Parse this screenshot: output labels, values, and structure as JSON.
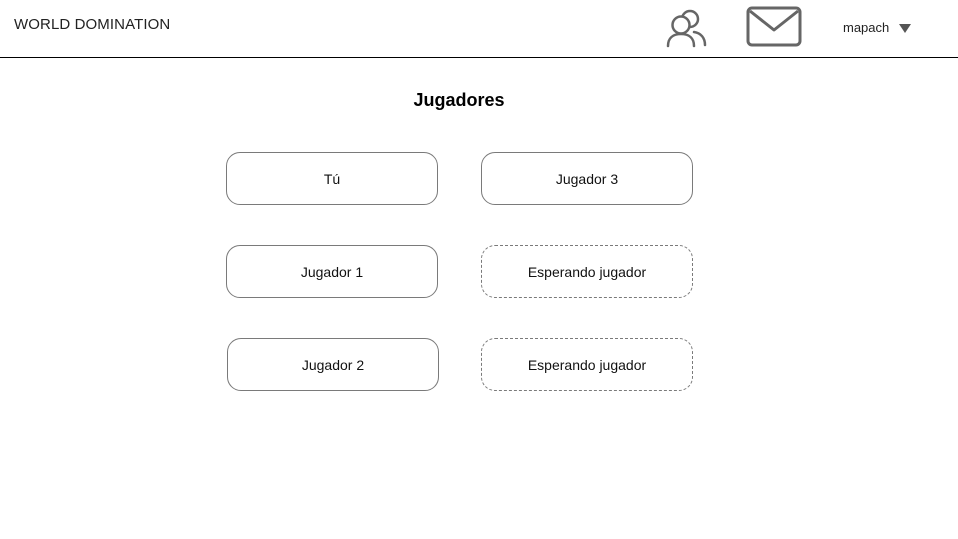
{
  "header": {
    "app_title": "WORLD DOMINATION",
    "friends_icon": "friends-icon",
    "mail_icon": "mail-icon",
    "username": "mapach",
    "dropdown_icon": "caret-down-icon"
  },
  "main": {
    "title": "Jugadores",
    "slots": [
      {
        "label": "Tú",
        "status": "occupied"
      },
      {
        "label": "Jugador 3",
        "status": "occupied"
      },
      {
        "label": "Jugador 1",
        "status": "occupied"
      },
      {
        "label": "Esperando jugador",
        "status": "waiting"
      },
      {
        "label": "Jugador 2",
        "status": "occupied"
      },
      {
        "label": "Esperando jugador",
        "status": "waiting"
      }
    ]
  },
  "colors": {
    "border": "#7a7a7a",
    "icon": "#666666"
  }
}
